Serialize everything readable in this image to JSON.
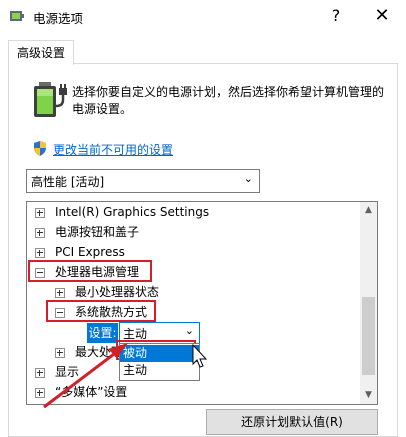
{
  "window": {
    "title": "电源选项",
    "help": "?",
    "close": "✕"
  },
  "tab": {
    "label": "高级设置"
  },
  "description": "选择你要自定义的电源计划，然后选择你希望计算机管理的电源设置。",
  "change_link": "更改当前不可用的设置",
  "plan_select": {
    "value": "高性能 [活动]"
  },
  "tree": {
    "items": [
      {
        "label": "Intel(R) Graphics Settings",
        "toggle": "+"
      },
      {
        "label": "电源按钮和盖子",
        "toggle": "+"
      },
      {
        "label": "PCI Express",
        "toggle": "+"
      },
      {
        "label": "处理器电源管理",
        "toggle": "-"
      },
      {
        "label": "最小处理器状态",
        "toggle": "+"
      },
      {
        "label": "系统散热方式",
        "toggle": "-"
      },
      {
        "label": "最大处理",
        "toggle": "+"
      },
      {
        "label": "显示",
        "toggle": "+"
      },
      {
        "label": "“多媒体”设置",
        "toggle": "+"
      }
    ]
  },
  "setting": {
    "label": "设置:",
    "value": "主动",
    "options": [
      "被动",
      "主动"
    ],
    "highlighted": "被动"
  },
  "restore_button": "还原计划默认值(R)",
  "colors": {
    "accent": "#0078d7",
    "annotation_red": "#d0202a",
    "link": "#0066cc"
  }
}
